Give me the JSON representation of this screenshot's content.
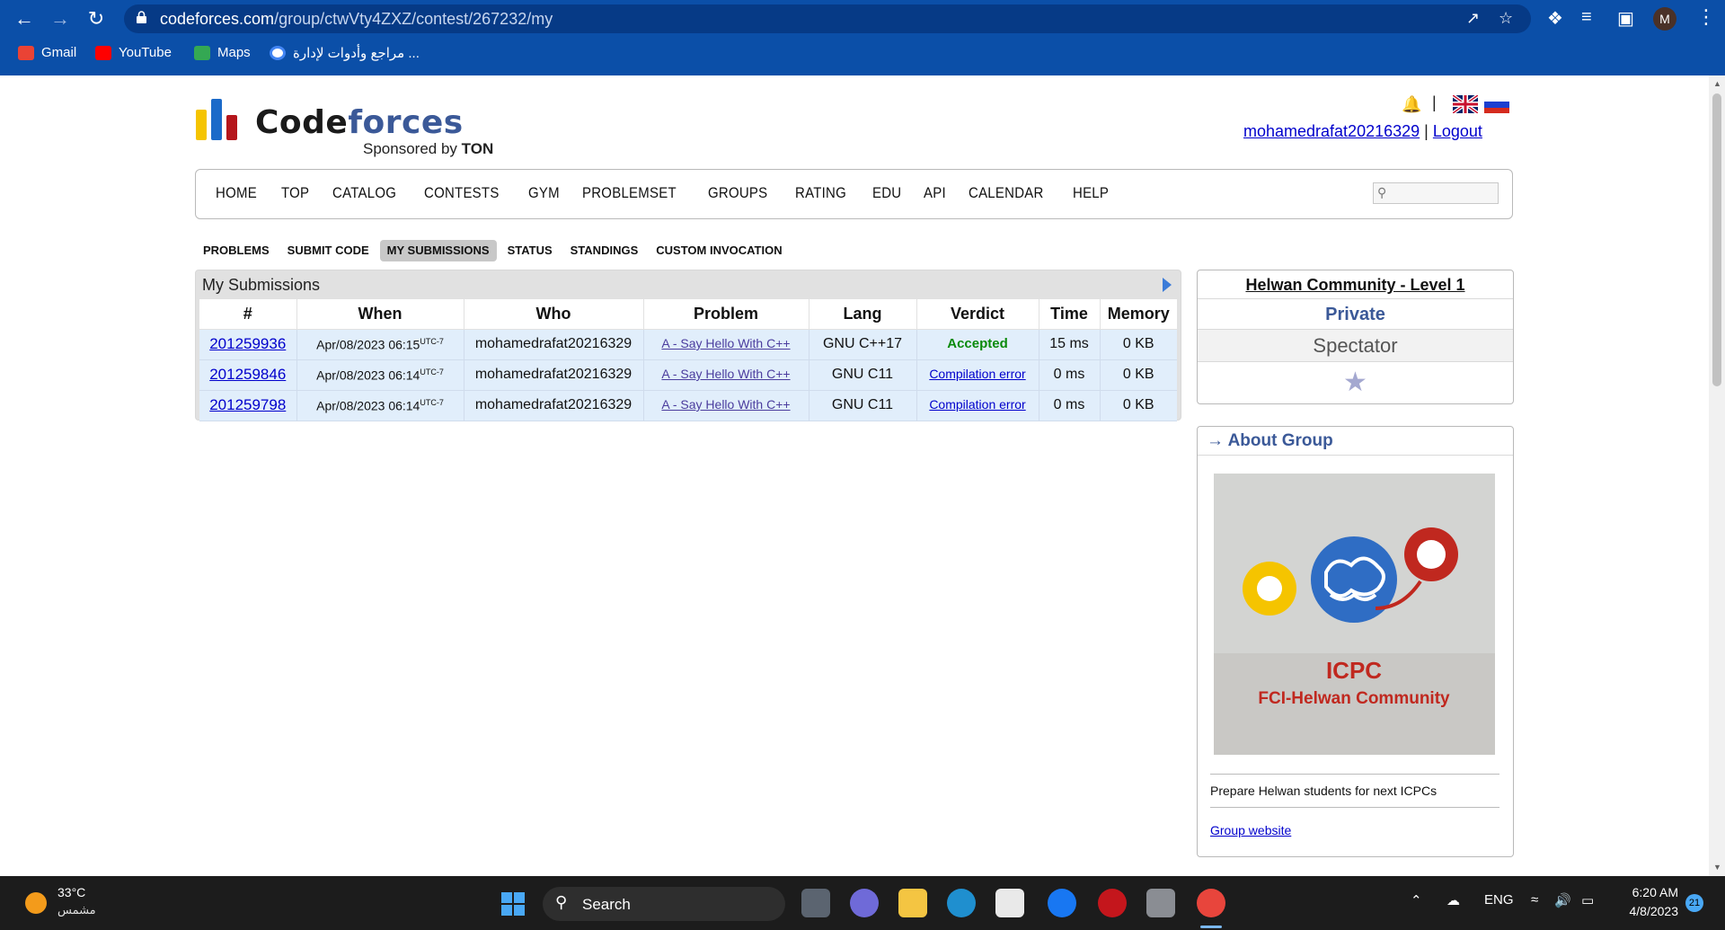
{
  "browser": {
    "url_host": "codeforces.com",
    "url_path": "/group/ctwVty4ZXZ/contest/267232/my",
    "profile_initial": "M",
    "bookmarks": [
      {
        "label": "Gmail",
        "icon": "gmail-icon",
        "color": "#ea4335"
      },
      {
        "label": "YouTube",
        "icon": "youtube-icon",
        "color": "#ff0000"
      },
      {
        "label": "Maps",
        "icon": "maps-icon",
        "color": "#34a853"
      },
      {
        "label": "مراجع وأدوات لإدارة ...",
        "icon": "google-icon",
        "color": "#4285f4"
      }
    ]
  },
  "site": {
    "logo_text_a": "Code",
    "logo_text_b": "forces",
    "sponsor_prefix": "Sponsored by ",
    "sponsor_name": "TON",
    "separator": "|",
    "username": "mohamedrafat20216329",
    "link_sep": "|",
    "logout": "Logout",
    "menu": [
      "HOME",
      "TOP",
      "CATALOG",
      "CONTESTS",
      "GYM",
      "PROBLEMSET",
      "GROUPS",
      "RATING",
      "EDU",
      "API",
      "CALENDAR",
      "HELP"
    ],
    "submenu": [
      "PROBLEMS",
      "SUBMIT CODE",
      "MY SUBMISSIONS",
      "STATUS",
      "STANDINGS",
      "CUSTOM INVOCATION"
    ],
    "submenu_active": "MY SUBMISSIONS"
  },
  "submissions": {
    "title": "My Submissions",
    "headers": [
      "#",
      "When",
      "Who",
      "Problem",
      "Lang",
      "Verdict",
      "Time",
      "Memory"
    ],
    "rows": [
      {
        "id": "201259936",
        "when": "Apr/08/2023 06:15",
        "tz": "UTC-7",
        "who": "mohamedrafat20216329",
        "problem": "A - Say Hello With C++",
        "lang": "GNU C++17",
        "verdict": "Accepted",
        "verdict_type": "ok",
        "time": "15 ms",
        "memory": "0 KB"
      },
      {
        "id": "201259846",
        "when": "Apr/08/2023 06:14",
        "tz": "UTC-7",
        "who": "mohamedrafat20216329",
        "problem": "A - Say Hello With C++",
        "lang": "GNU C11",
        "verdict": "Compilation error",
        "verdict_type": "ce",
        "time": "0 ms",
        "memory": "0 KB"
      },
      {
        "id": "201259798",
        "when": "Apr/08/2023 06:14",
        "tz": "UTC-7",
        "who": "mohamedrafat20216329",
        "problem": "A - Say Hello With C++",
        "lang": "GNU C11",
        "verdict": "Compilation error",
        "verdict_type": "ce",
        "time": "0 ms",
        "memory": "0 KB"
      }
    ]
  },
  "group": {
    "name": "Helwan Community - Level 1",
    "privacy": "Private",
    "role": "Spectator",
    "about_title": "→ About Group",
    "image_text_1": "ICPC",
    "image_text_2": "FCI-Helwan Community",
    "description": "Prepare Helwan students for next ICPCs",
    "website_label": "Group website"
  },
  "taskbar": {
    "temperature": "33°C",
    "weather_desc": "مشمس",
    "search_label": "Search",
    "lang": "ENG",
    "time": "6:20 AM",
    "date": "4/8/2023",
    "notification_count": "21"
  }
}
